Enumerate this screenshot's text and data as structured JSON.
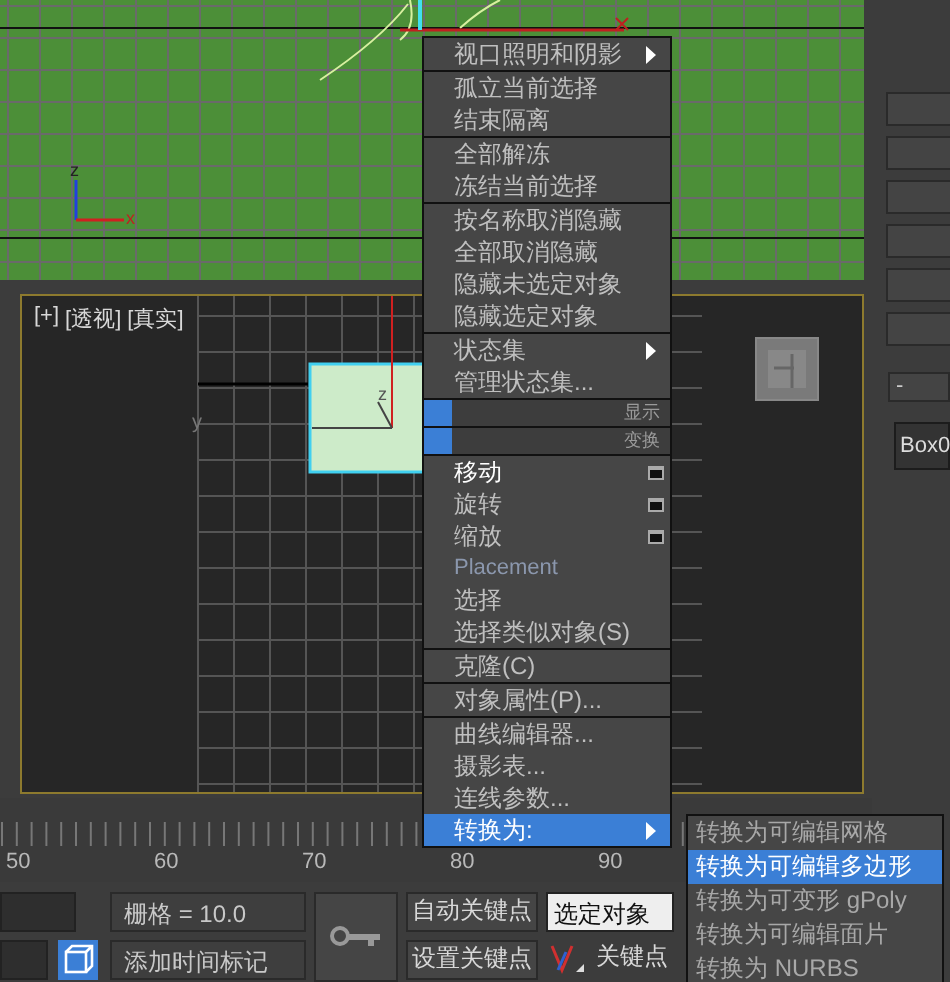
{
  "top_viewport": {
    "gizmo_labels": [
      "z",
      "x"
    ]
  },
  "perspective_viewport": {
    "labels": [
      "[+]",
      "[透视]",
      "[真实]"
    ],
    "gizmo_labels": [
      "y",
      "z"
    ]
  },
  "right_panel": {
    "field": "-",
    "object_name": "Box0"
  },
  "timeline": {
    "ticks": [
      "50",
      "60",
      "70",
      "80",
      "90"
    ]
  },
  "bottom_bar": {
    "grid_field": "栅格 = 10.0",
    "time_tag": "添加时间标记",
    "auto_key": "自动关键点",
    "set_key": "设置关键点",
    "key_filter": "选定对象",
    "keys_label": "关键点"
  },
  "quad_menu": [
    {
      "kind": "item",
      "label": "视口照明和阴影",
      "submenu": true,
      "options": false,
      "emphasized": false,
      "disabled": false,
      "selected": false
    },
    {
      "kind": "separator"
    },
    {
      "kind": "item",
      "label": "孤立当前选择",
      "submenu": false,
      "options": false,
      "emphasized": false,
      "disabled": false,
      "selected": false
    },
    {
      "kind": "item",
      "label": "结束隔离",
      "submenu": false,
      "options": false,
      "emphasized": false,
      "disabled": false,
      "selected": false
    },
    {
      "kind": "separator"
    },
    {
      "kind": "item",
      "label": "全部解冻",
      "submenu": false,
      "options": false,
      "emphasized": false,
      "disabled": false,
      "selected": false
    },
    {
      "kind": "item",
      "label": "冻结当前选择",
      "submenu": false,
      "options": false,
      "emphasized": false,
      "disabled": false,
      "selected": false
    },
    {
      "kind": "separator"
    },
    {
      "kind": "item",
      "label": "按名称取消隐藏",
      "submenu": false,
      "options": false,
      "emphasized": false,
      "disabled": false,
      "selected": false
    },
    {
      "kind": "item",
      "label": "全部取消隐藏",
      "submenu": false,
      "options": false,
      "emphasized": false,
      "disabled": false,
      "selected": false
    },
    {
      "kind": "item",
      "label": "隐藏未选定对象",
      "submenu": false,
      "options": false,
      "emphasized": false,
      "disabled": false,
      "selected": false
    },
    {
      "kind": "item",
      "label": "隐藏选定对象",
      "submenu": false,
      "options": false,
      "emphasized": false,
      "disabled": false,
      "selected": false
    },
    {
      "kind": "separator"
    },
    {
      "kind": "item",
      "label": "状态集",
      "submenu": true,
      "options": false,
      "emphasized": false,
      "disabled": false,
      "selected": false
    },
    {
      "kind": "item",
      "label": "管理状态集...",
      "submenu": false,
      "options": false,
      "emphasized": false,
      "disabled": false,
      "selected": false
    },
    {
      "kind": "separator"
    },
    {
      "kind": "header",
      "label": "显示"
    },
    {
      "kind": "separator"
    },
    {
      "kind": "header",
      "label": "变换"
    },
    {
      "kind": "separator"
    },
    {
      "kind": "item",
      "label": "移动",
      "submenu": false,
      "options": true,
      "emphasized": true,
      "disabled": false,
      "selected": false
    },
    {
      "kind": "item",
      "label": "旋转",
      "submenu": false,
      "options": true,
      "emphasized": false,
      "disabled": false,
      "selected": false
    },
    {
      "kind": "item",
      "label": "缩放",
      "submenu": false,
      "options": true,
      "emphasized": false,
      "disabled": false,
      "selected": false
    },
    {
      "kind": "item",
      "label": "Placement",
      "submenu": false,
      "options": false,
      "emphasized": false,
      "disabled": true,
      "selected": false
    },
    {
      "kind": "item",
      "label": "选择",
      "submenu": false,
      "options": false,
      "emphasized": false,
      "disabled": false,
      "selected": false
    },
    {
      "kind": "item",
      "label": "选择类似对象(S)",
      "submenu": false,
      "options": false,
      "emphasized": false,
      "disabled": false,
      "selected": false
    },
    {
      "kind": "separator"
    },
    {
      "kind": "item",
      "label": "克隆(C)",
      "submenu": false,
      "options": false,
      "emphasized": false,
      "disabled": false,
      "selected": false
    },
    {
      "kind": "separator"
    },
    {
      "kind": "item",
      "label": "对象属性(P)...",
      "submenu": false,
      "options": false,
      "emphasized": false,
      "disabled": false,
      "selected": false
    },
    {
      "kind": "separator"
    },
    {
      "kind": "item",
      "label": "曲线编辑器...",
      "submenu": false,
      "options": false,
      "emphasized": false,
      "disabled": false,
      "selected": false
    },
    {
      "kind": "item",
      "label": "摄影表...",
      "submenu": false,
      "options": false,
      "emphasized": false,
      "disabled": false,
      "selected": false
    },
    {
      "kind": "item",
      "label": "连线参数...",
      "submenu": false,
      "options": false,
      "emphasized": false,
      "disabled": false,
      "selected": false
    },
    {
      "kind": "item",
      "label": "转换为:",
      "submenu": true,
      "options": false,
      "emphasized": false,
      "disabled": false,
      "selected": true
    }
  ],
  "submenu": [
    {
      "label": "转换为可编辑网格",
      "selected": false
    },
    {
      "label": "转换为可编辑多边形",
      "selected": true
    },
    {
      "label": "转换为可变形 gPoly",
      "selected": false
    },
    {
      "label": "转换为可编辑面片",
      "selected": false
    },
    {
      "label": "转换为 NURBS",
      "selected": false
    }
  ]
}
